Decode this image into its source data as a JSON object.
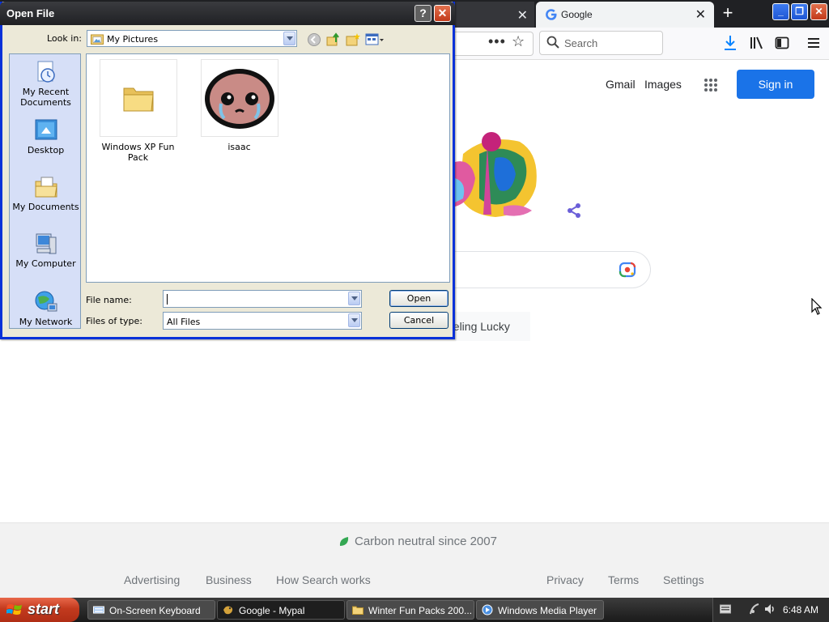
{
  "browser": {
    "tabs": [
      {
        "label": ""
      },
      {
        "label": "Google"
      }
    ],
    "new_tab_symbol": "+",
    "search_placeholder": "Search",
    "window_controls": {
      "minimize": "_",
      "restore": "❐",
      "close": "✕"
    }
  },
  "google": {
    "gmail": "Gmail",
    "images": "Images",
    "sign_in": "Sign in",
    "lucky_partial": "eeling Lucky",
    "carbon": "Carbon neutral since 2007",
    "footer_links": [
      "Advertising",
      "Business",
      "How Search works",
      "Privacy",
      "Terms",
      "Settings"
    ],
    "colors": {
      "sign_in_bg": "#1a73e8",
      "leaf": "#34a853"
    }
  },
  "dialog": {
    "title": "Open File",
    "help": "?",
    "close": "✕",
    "look_in_label": "Look in:",
    "look_in_value": "My Pictures",
    "places": [
      "My Recent Documents",
      "Desktop",
      "My Documents",
      "My Computer",
      "My Network"
    ],
    "files": [
      {
        "name": "Windows XP Fun Pack",
        "icon": "folder-icon"
      },
      {
        "name": "isaac",
        "icon": "isaac-thumbnail"
      }
    ],
    "file_name_label": "File name:",
    "file_name_value": "",
    "files_of_type_label": "Files of type:",
    "files_of_type_value": "All Files",
    "open": "Open",
    "cancel": "Cancel"
  },
  "taskbar": {
    "start": "start",
    "tasks": [
      {
        "label": "On-Screen Keyboard",
        "icon": "keyboard-icon"
      },
      {
        "label": "Google - Mypal",
        "icon": "mypal-icon"
      },
      {
        "label": "Winter Fun Packs 200...",
        "icon": "folder-icon"
      },
      {
        "label": "Windows Media Player",
        "icon": "media-player-icon"
      }
    ],
    "clock": "6:48 AM"
  }
}
